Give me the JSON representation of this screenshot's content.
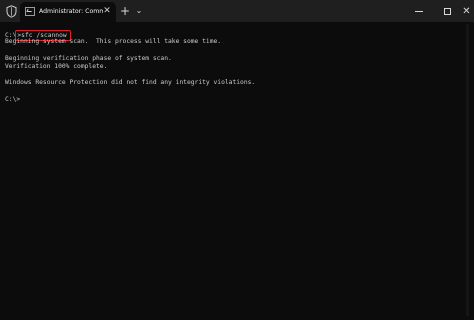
{
  "titlebar": {
    "tab_title": "Administrator: Command Prom",
    "tab_close": "✕",
    "new_tab": "+",
    "dropdown": "⌄",
    "close": "✕"
  },
  "console": {
    "prompt": "C:\\",
    "command": ">sfc /scannow",
    "lines": [
      "Beginning system scan.  This process will take some time.",
      "",
      "Beginning verification phase of system scan.",
      "Verification 100% complete.",
      "",
      "Windows Resource Protection did not find any integrity violations.",
      ""
    ],
    "final_prompt": "C:\\>"
  },
  "colors": {
    "background": "#0c0c0c",
    "titlebar": "#1f1f1f",
    "text": "#cccccc",
    "highlight_box": "#e0202a"
  },
  "icons": {
    "app": "shield-icon",
    "tab": "terminal-icon"
  }
}
